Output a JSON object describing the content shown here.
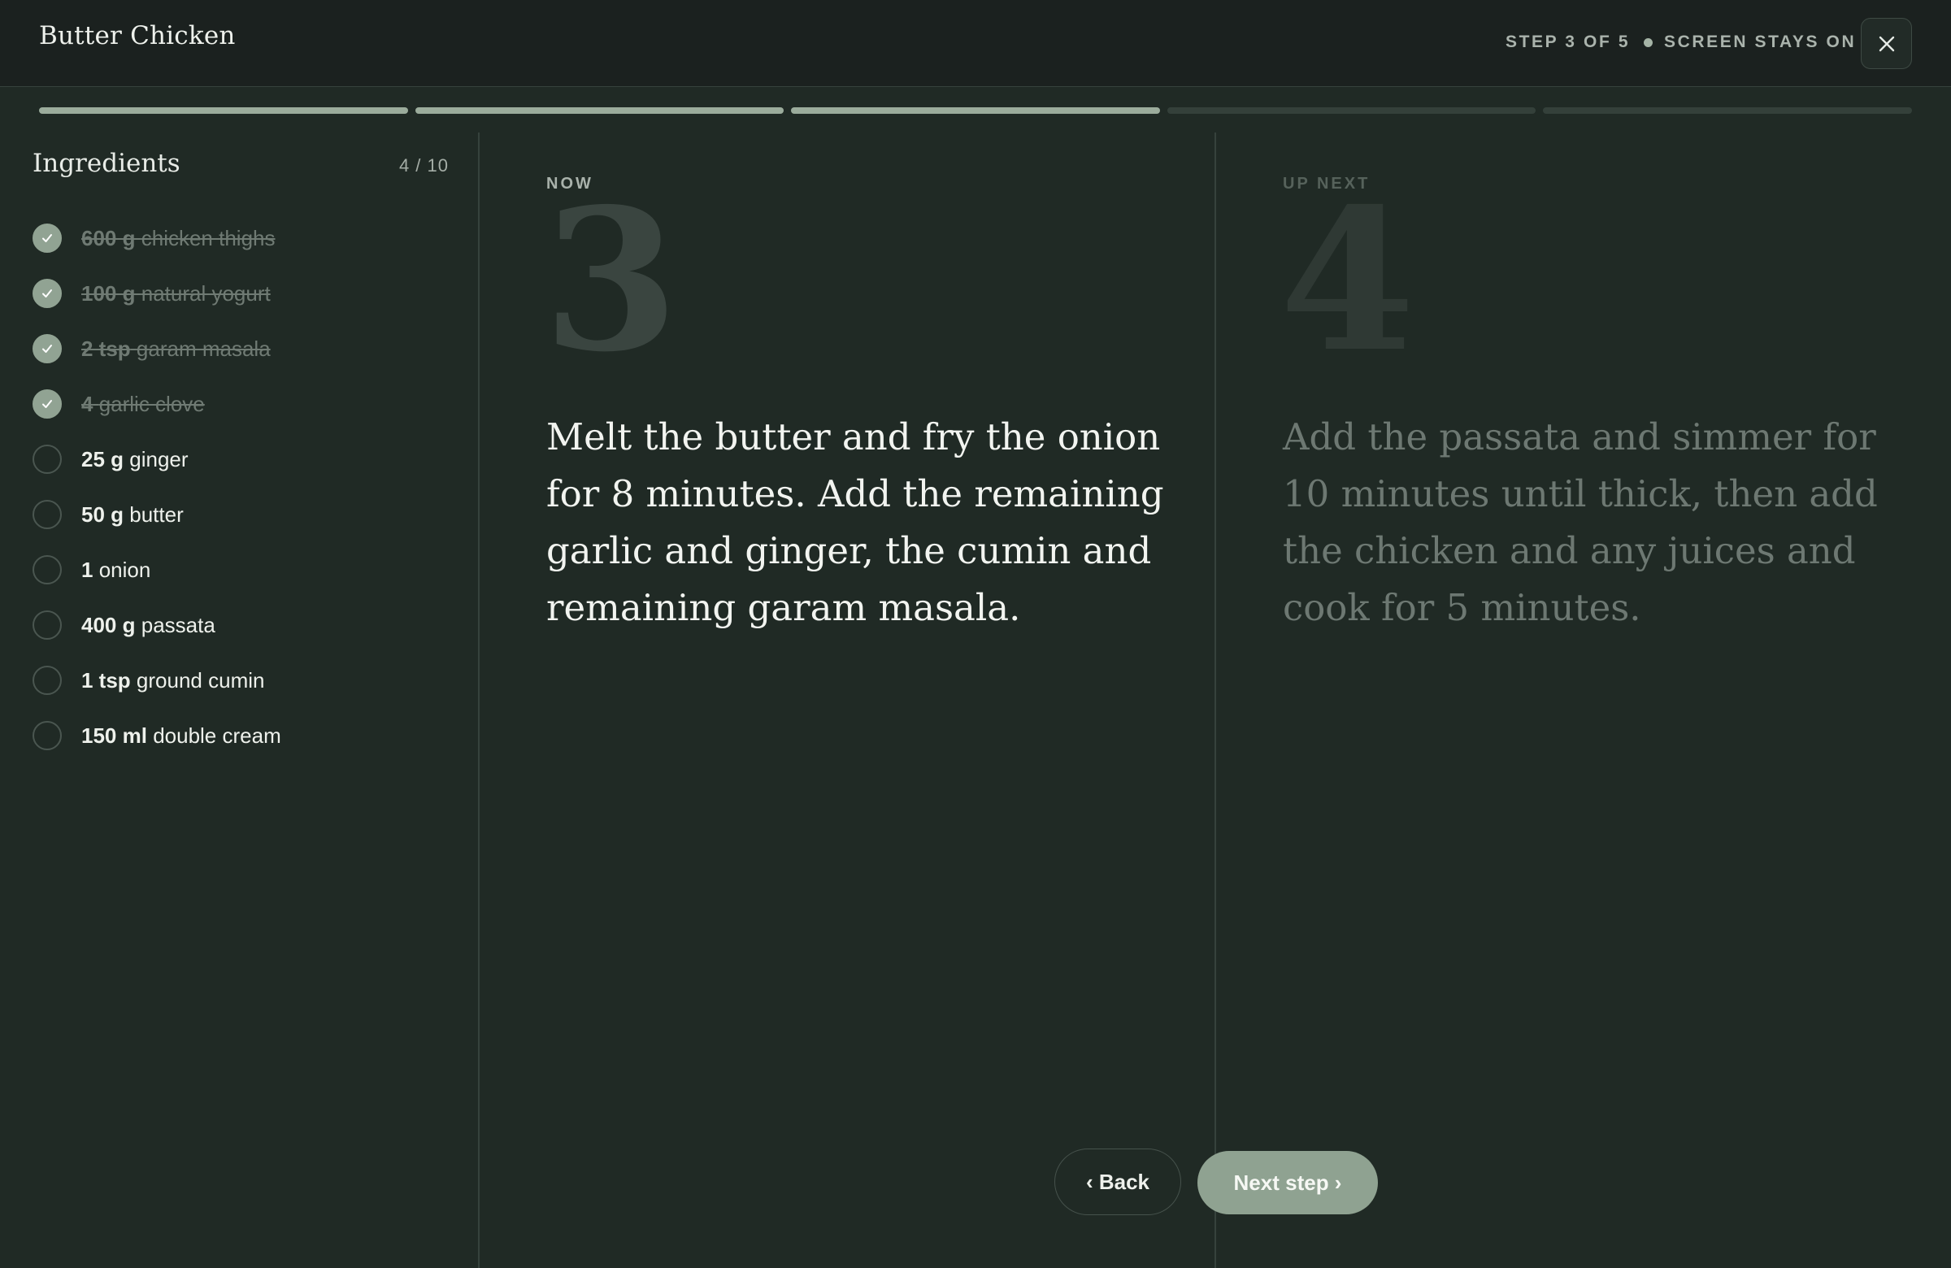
{
  "header": {
    "title": "Butter Chicken",
    "step_indicator": "STEP 3 OF 5",
    "screen_status": "SCREEN STAYS ON",
    "close_icon": "close-icon"
  },
  "progress": {
    "total_steps": 5,
    "completed_steps": 3,
    "accent_color": "#9bac9c"
  },
  "ingredients": {
    "title": "Ingredients",
    "count": "4 / 10",
    "items": [
      {
        "qty": "600 g",
        "name": "chicken thighs",
        "checked": true
      },
      {
        "qty": "100 g",
        "name": "natural yogurt",
        "checked": true
      },
      {
        "qty": "2 tsp",
        "name": "garam masala",
        "checked": true
      },
      {
        "qty": "4",
        "name": "garlic clove",
        "checked": true
      },
      {
        "qty": "25 g",
        "name": "ginger",
        "checked": false
      },
      {
        "qty": "50 g",
        "name": "butter",
        "checked": false
      },
      {
        "qty": "1",
        "name": "onion",
        "checked": false
      },
      {
        "qty": "400 g",
        "name": "passata",
        "checked": false
      },
      {
        "qty": "1 tsp",
        "name": "ground cumin",
        "checked": false
      },
      {
        "qty": "150 ml",
        "name": "double cream",
        "checked": false
      }
    ]
  },
  "now": {
    "label": "NOW",
    "number": "3",
    "text": "Melt the butter and fry the onion for 8 minutes. Add the remaining garlic and ginger, the cumin and remaining garam masala."
  },
  "next": {
    "label": "UP NEXT",
    "number": "4",
    "text": "Add the passata and simmer for 10 minutes until thick, then add the chicken and any juices and cook for 5 minutes."
  },
  "nav": {
    "back_label": "‹ Back",
    "next_label": "Next step ›"
  }
}
